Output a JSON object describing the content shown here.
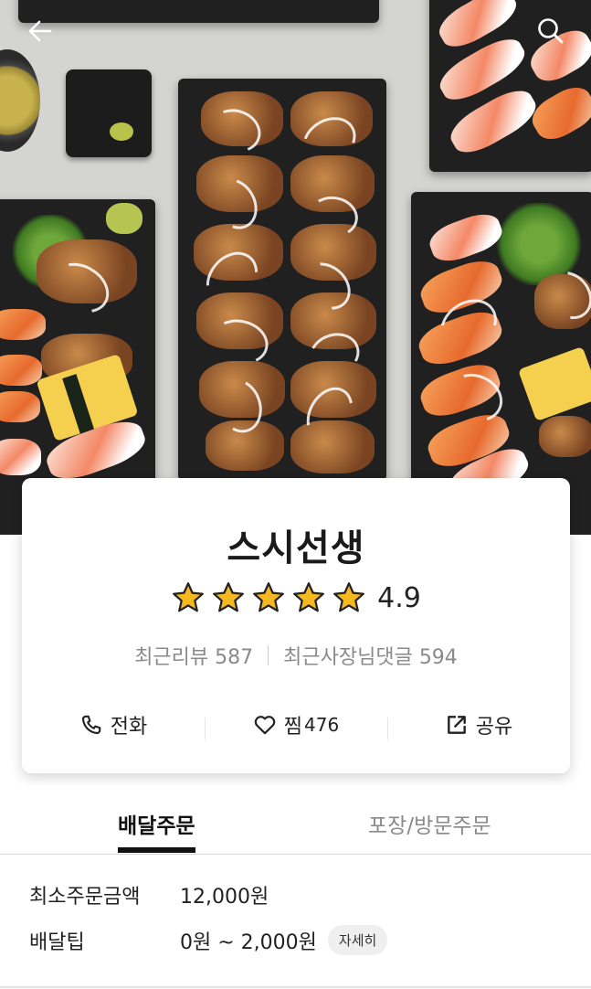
{
  "store": {
    "name": "스시선생",
    "rating": "4.9",
    "star_count": 5,
    "recent_reviews_label": "최근리뷰 587",
    "recent_owner_replies_label": "최근사장님댓글 594"
  },
  "actions": {
    "call_label": "전화",
    "like_label": "찜",
    "like_count": "476",
    "share_label": "공유"
  },
  "tabs": [
    {
      "label": "배달주문",
      "selected": true
    },
    {
      "label": "포장/방문주문",
      "selected": false
    }
  ],
  "delivery_info": {
    "min_order_label": "최소주문금액",
    "min_order_value": "12,000원",
    "tip_label": "배달팁",
    "tip_value": "0원 ~ 2,000원",
    "detail_button": "자세히"
  },
  "icons": {
    "back": "arrow-left-icon",
    "search": "search-icon",
    "star": "star-icon",
    "call": "phone-icon",
    "like": "heart-icon",
    "share": "share-icon"
  },
  "colors": {
    "star_fill": "#f5b820",
    "text_primary": "#222222",
    "text_secondary": "#8a8a8a",
    "tab_indicator": "#111111"
  }
}
